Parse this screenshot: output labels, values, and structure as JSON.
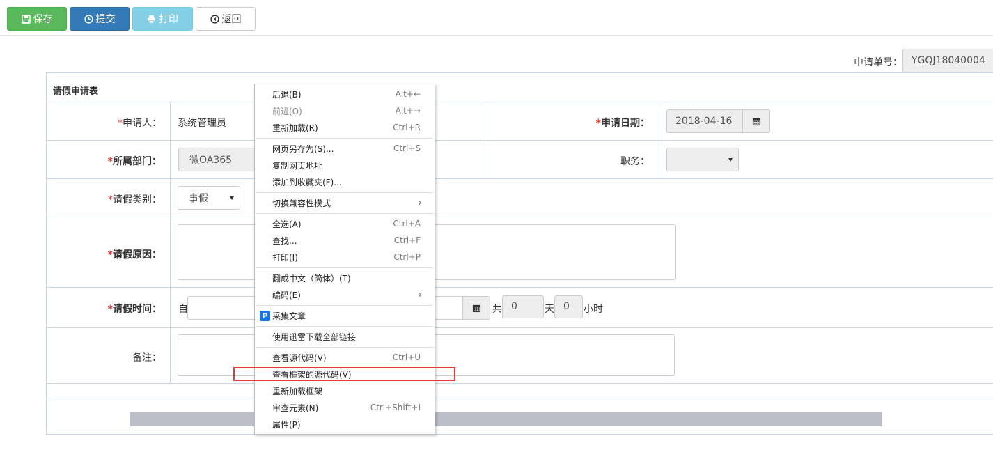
{
  "toolbar": {
    "save_label": "保存",
    "submit_label": "提交",
    "print_label": "打印",
    "back_label": "返回"
  },
  "serial": {
    "label": "申请单号：",
    "value": "YGQJ18040004"
  },
  "form": {
    "title": "请假申请表",
    "applicant_label": "申请人：",
    "applicant_value": "系统管理员",
    "apply_date_label": "申请日期：",
    "apply_date_value": "2018-04-16",
    "dept_label": "所属部门：",
    "dept_value": "微OA365",
    "position_label": "职务：",
    "position_value": "",
    "leave_type_label": "请假类别：",
    "leave_type_value": "事假",
    "reason_label": "请假原因：",
    "time_label": "请假时间：",
    "from_label": "自",
    "total_label": "共",
    "days_value": "0",
    "days_unit": "天",
    "hours_value": "0",
    "hours_unit": "小时",
    "remark_label": "备注：",
    "required_mark": "*"
  },
  "context_menu": {
    "items": [
      {
        "label": "后退(B)",
        "shortcut": "Alt+←"
      },
      {
        "label": "前进(O)",
        "shortcut": "Alt+→",
        "disabled": true
      },
      {
        "label": "重新加载(R)",
        "shortcut": "Ctrl+R"
      },
      {
        "label": "网页另存为(S)...",
        "shortcut": "Ctrl+S"
      },
      {
        "label": "复制网页地址",
        "shortcut": ""
      },
      {
        "label": "添加到收藏夹(F)...",
        "shortcut": ""
      },
      {
        "label": "切换兼容性模式",
        "submenu": true
      },
      {
        "label": "全选(A)",
        "shortcut": "Ctrl+A"
      },
      {
        "label": "查找...",
        "shortcut": "Ctrl+F"
      },
      {
        "label": "打印(I)",
        "shortcut": "Ctrl+P"
      },
      {
        "label": "翻成中文（简体）(T)",
        "shortcut": ""
      },
      {
        "label": "编码(E)",
        "submenu": true
      },
      {
        "label": "采集文章",
        "icon": "P"
      },
      {
        "label": "使用迅雷下载全部链接",
        "shortcut": ""
      },
      {
        "label": "查看源代码(V)",
        "shortcut": "Ctrl+U"
      },
      {
        "label": "查看框架的源代码(V)",
        "shortcut": ""
      },
      {
        "label": "重新加载框架",
        "shortcut": ""
      },
      {
        "label": "审查元素(N)",
        "shortcut": "Ctrl+Shift+I"
      },
      {
        "label": "属性(P)",
        "shortcut": ""
      }
    ]
  },
  "colors": {
    "save": "#5cb85c",
    "submit": "#337ab7",
    "print": "#5bc0de",
    "required": "#e33333",
    "highlight_border": "#e53935"
  }
}
